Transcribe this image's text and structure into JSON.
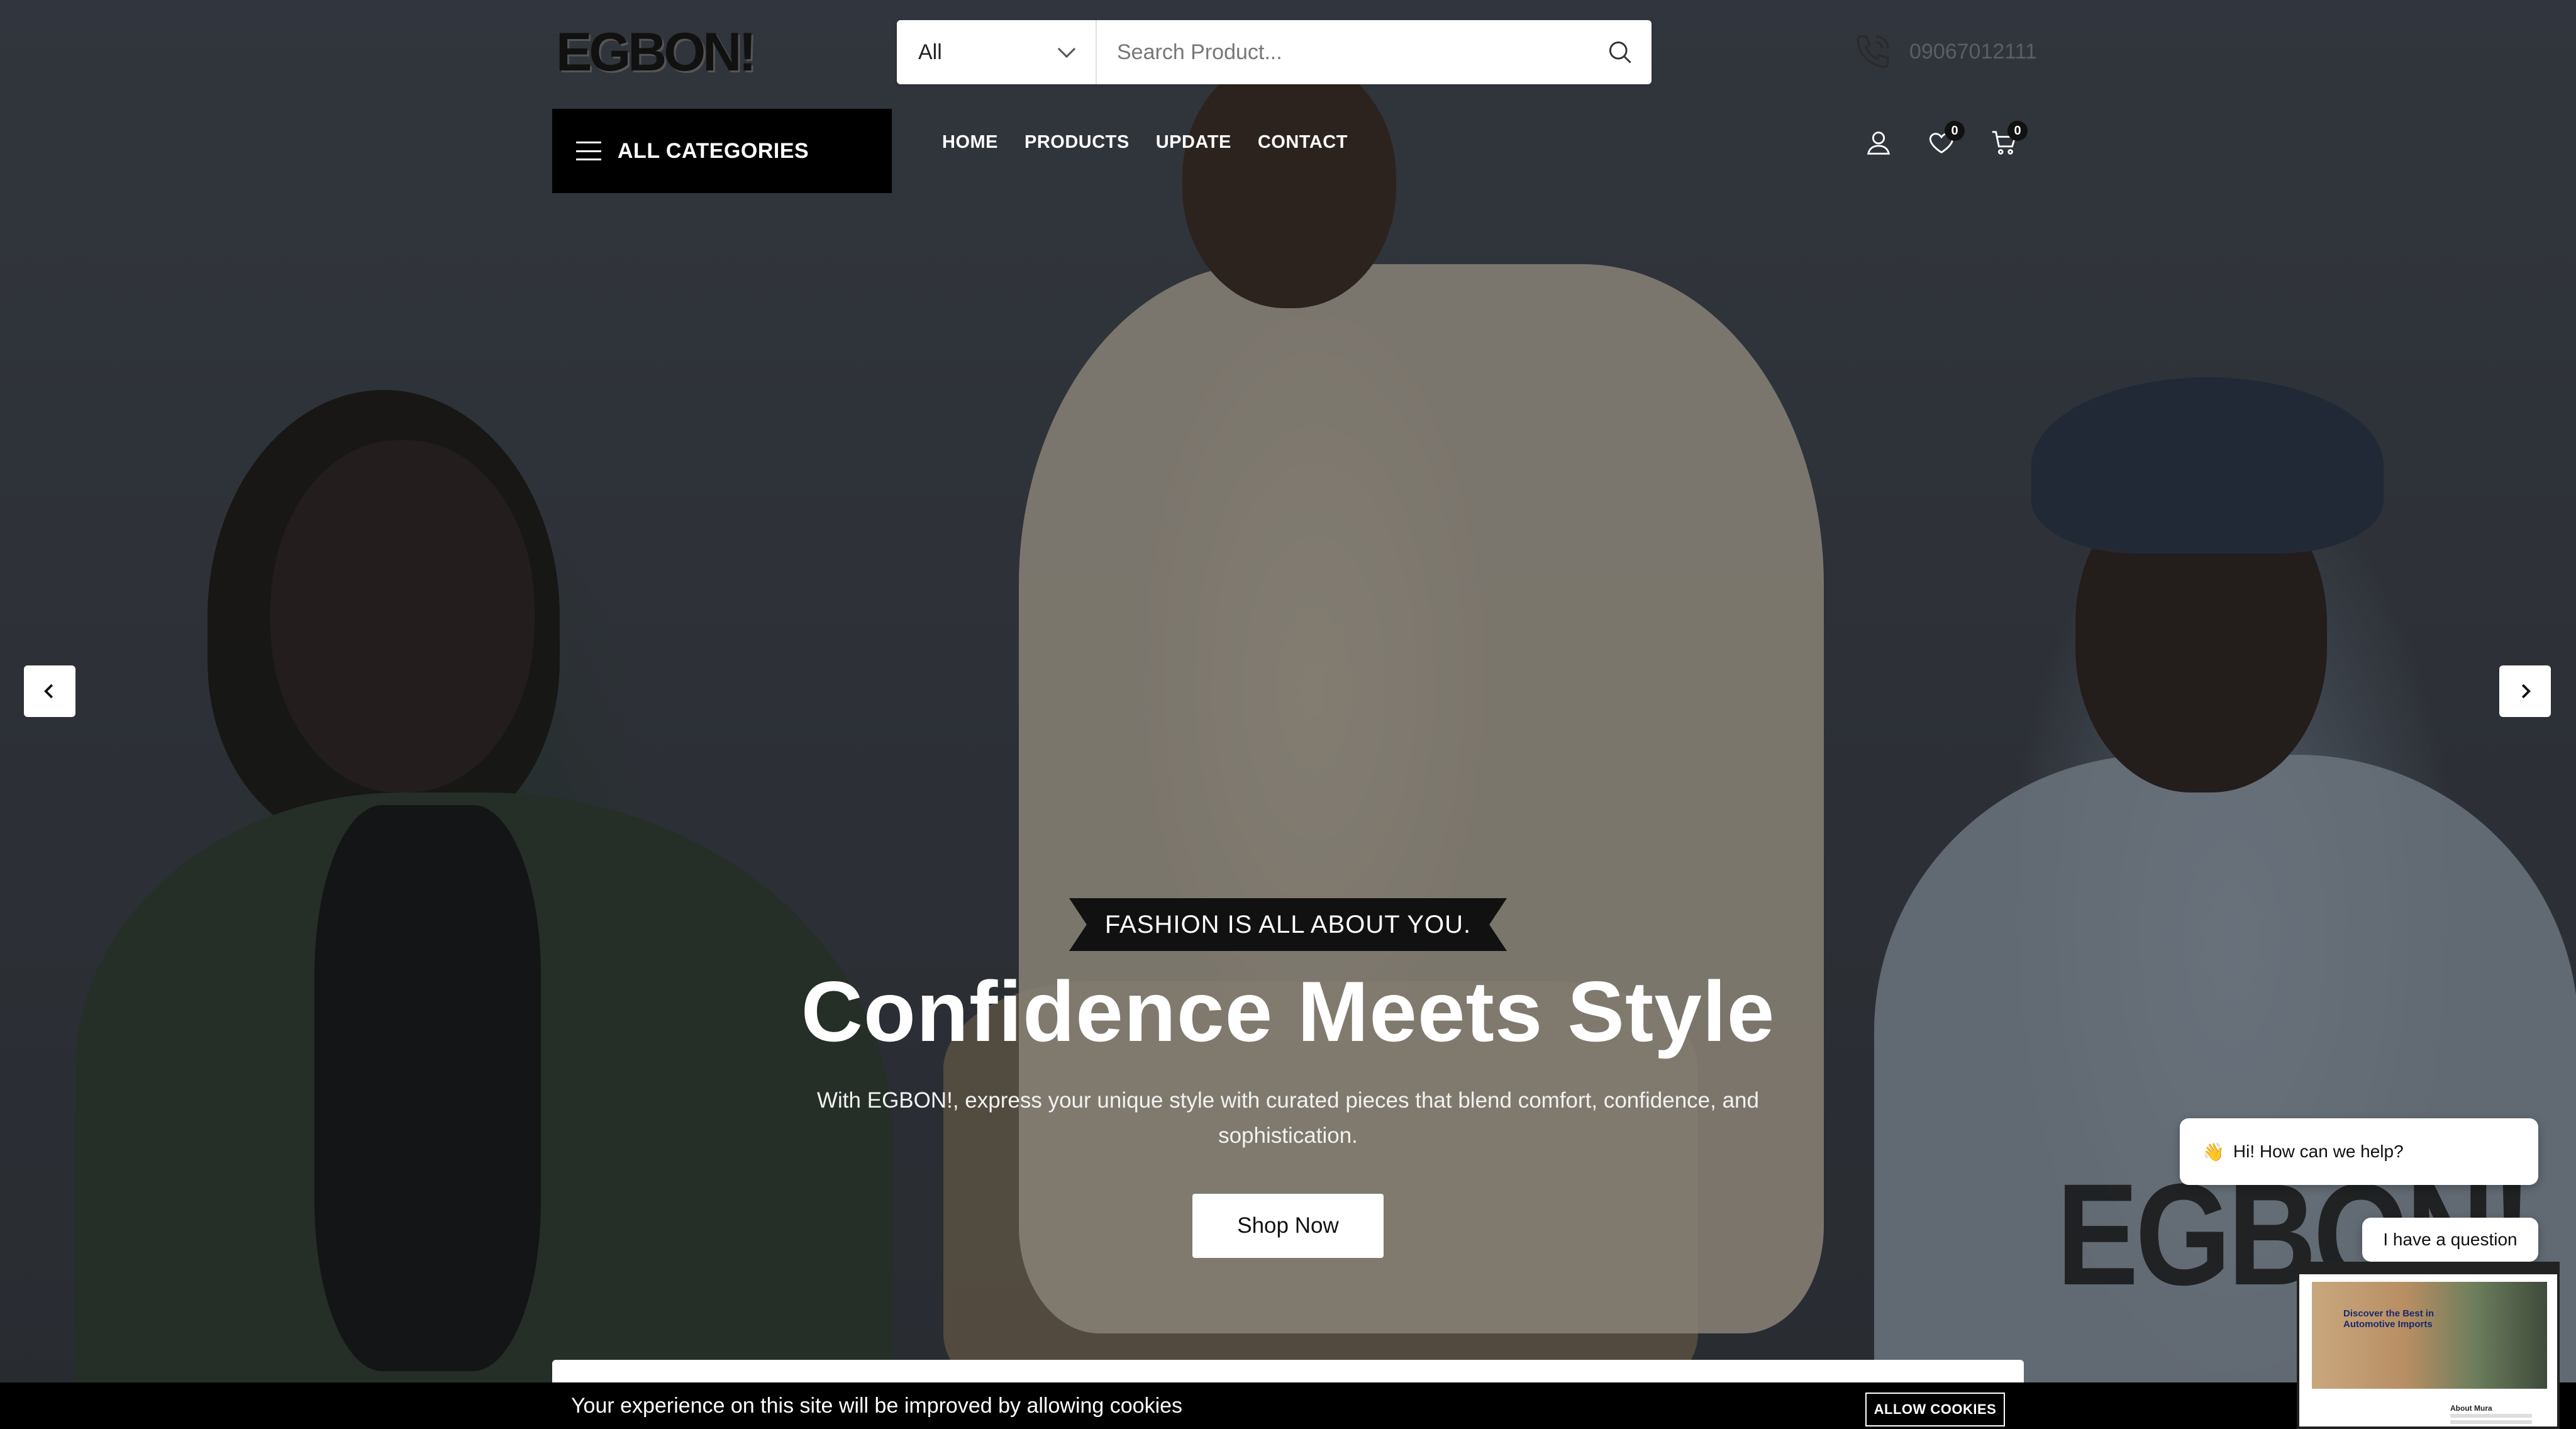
{
  "brand": {
    "logo_text": "EGBON!",
    "watermark_text": "EGBON!"
  },
  "search": {
    "category_selected": "All",
    "placeholder": "Search Product...",
    "value": ""
  },
  "contact": {
    "phone": "09067012111"
  },
  "categories_button": {
    "label": "ALL CATEGORIES"
  },
  "nav": {
    "items": [
      {
        "label": "HOME"
      },
      {
        "label": "PRODUCTS"
      },
      {
        "label": "UPDATE"
      },
      {
        "label": "CONTACT"
      }
    ]
  },
  "user_tools": {
    "wishlist_count": "0",
    "cart_count": "0"
  },
  "hero": {
    "tagline": "FASHION IS ALL ABOUT YOU.",
    "headline": "Confidence Meets Style",
    "subtext": "With EGBON!, express your unique style with curated pieces that blend comfort, confidence, and sophistication.",
    "cta_label": "Shop Now"
  },
  "cookie": {
    "message": "Your experience on this site will be improved by allowing cookies",
    "button_label": "ALLOW COOKIES"
  },
  "chat": {
    "greeting": "Hi! How can we help?",
    "greeting_emoji": "👋",
    "quick_reply": "I have a question",
    "preview_headline": "Discover the Best in Automotive Imports",
    "preview_label": "About Mura"
  },
  "icons": {
    "menu": "hamburger-icon",
    "search": "search-icon",
    "phone": "phone-icon",
    "user": "user-icon",
    "wishlist": "heart-icon",
    "cart": "cart-icon",
    "prev": "chevron-left-icon",
    "next": "chevron-right-icon"
  },
  "colors": {
    "accent": "#000000",
    "text_light": "#ffffff",
    "phone_text": "#5b5e64"
  }
}
